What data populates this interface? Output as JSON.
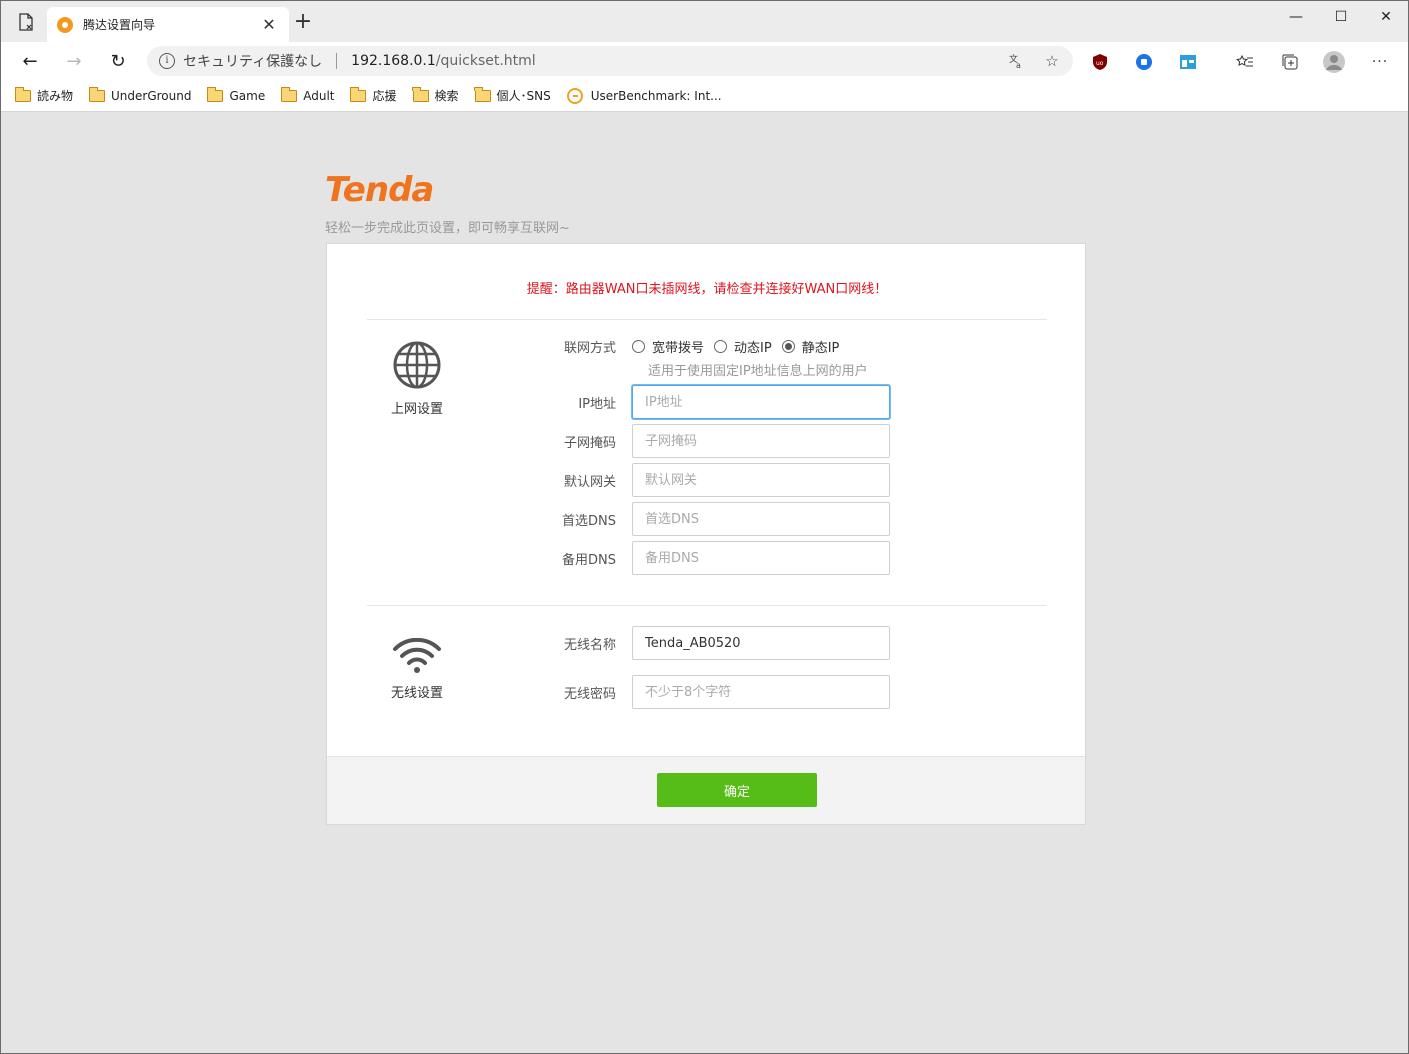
{
  "browser": {
    "tab_title": "腾达设置向导",
    "tab_close": "✕",
    "new_tab": "+",
    "window_controls": {
      "minimize": "—",
      "maximize": "☐",
      "close": "✕"
    },
    "nav": {
      "back": "←",
      "forward": "→",
      "refresh": "↻"
    },
    "omnibox": {
      "security_text": "セキュリティ保護なし",
      "url_host": "192.168.0.1",
      "url_path": "/quickset.html"
    },
    "menu": "···"
  },
  "bookmarks": [
    {
      "label": "読み物",
      "icon": "folder-icon"
    },
    {
      "label": "UnderGround",
      "icon": "folder-icon"
    },
    {
      "label": "Game",
      "icon": "folder-icon"
    },
    {
      "label": "Adult",
      "icon": "folder-icon"
    },
    {
      "label": "応援",
      "icon": "folder-icon"
    },
    {
      "label": "検索",
      "icon": "folder-icon"
    },
    {
      "label": "個人･SNS",
      "icon": "folder-icon"
    },
    {
      "label": "UserBenchmark: Int...",
      "icon": "userbenchmark-icon"
    }
  ],
  "page": {
    "brand": "Tenda",
    "brand_color": "#f0731e",
    "tagline": "轻松一步完成此页设置，即可畅享互联网~",
    "warning": "提醒：路由器WAN口未插网线，请检查并连接好WAN口网线！",
    "internet": {
      "section_label": "上网设置",
      "mode_label": "联网方式",
      "modes": [
        {
          "label": "宽带拨号",
          "checked": false
        },
        {
          "label": "动态IP",
          "checked": false
        },
        {
          "label": "静态IP",
          "checked": true
        }
      ],
      "mode_hint": "适用于使用固定IP地址信息上网的用户",
      "fields": [
        {
          "label": "IP地址",
          "placeholder": "IP地址",
          "value": ""
        },
        {
          "label": "子网掩码",
          "placeholder": "子网掩码",
          "value": ""
        },
        {
          "label": "默认网关",
          "placeholder": "默认网关",
          "value": ""
        },
        {
          "label": "首选DNS",
          "placeholder": "首选DNS",
          "value": ""
        },
        {
          "label": "备用DNS",
          "placeholder": "备用DNS",
          "value": ""
        }
      ]
    },
    "wireless": {
      "section_label": "无线设置",
      "ssid_label": "无线名称",
      "ssid_value": "Tenda_AB0520",
      "password_label": "无线密码",
      "password_placeholder": "不少于8个字符"
    },
    "confirm_label": "确定",
    "confirm_color": "#56bd18",
    "warning_color": "#e0141e"
  }
}
